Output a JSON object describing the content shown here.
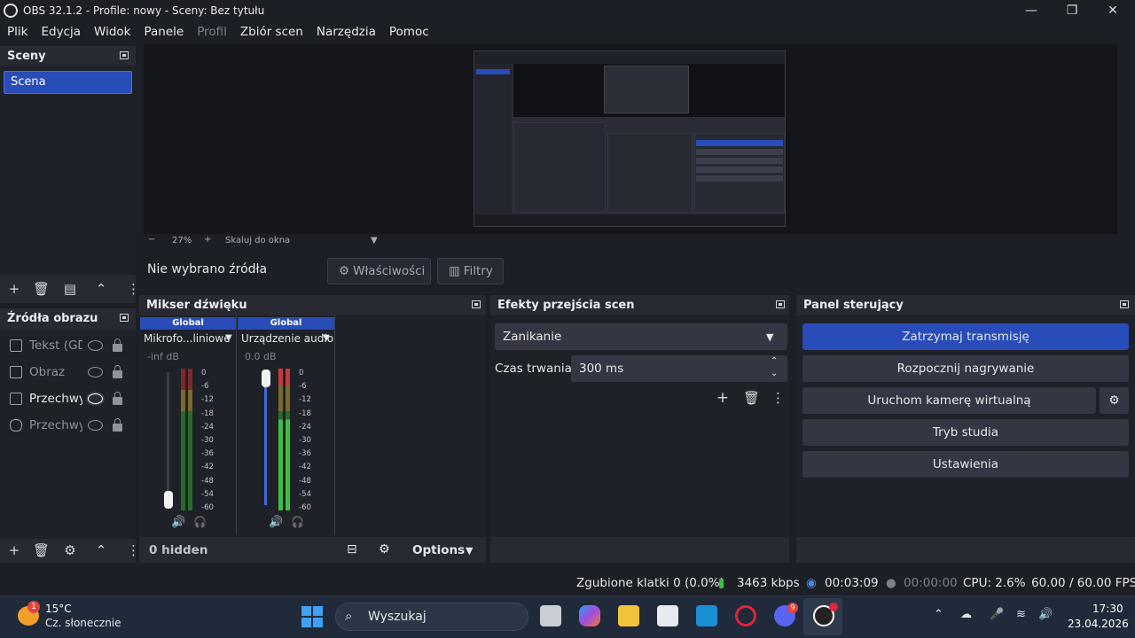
{
  "window": {
    "title": "OBS 32.1.2 - Profile: nowy - Sceny: Bez tytułu"
  },
  "menu": [
    "Plik",
    "Edycja",
    "Widok",
    "Panele",
    "Profil",
    "Zbiór scen",
    "Narzędzia",
    "Pomoc"
  ],
  "scenes": {
    "title": "Sceny",
    "items": [
      "Scena"
    ]
  },
  "sources": {
    "title": "Źródła obrazu",
    "items": [
      {
        "label": "Tekst (GDI",
        "icon": "text-icon",
        "visible": false
      },
      {
        "label": "Obraz",
        "icon": "image-icon",
        "visible": false
      },
      {
        "label": "Przechwy",
        "icon": "display-capture-icon",
        "visible": true
      },
      {
        "label": "Przechwy",
        "icon": "game-capture-icon",
        "visible": false
      }
    ]
  },
  "preview": {
    "zoom": "27%",
    "scale_mode": "Skaluj do okna",
    "minus": "−",
    "plus": "+"
  },
  "source_toolbar": {
    "no_source": "Nie wybrano źródła",
    "properties": "Właściwości",
    "filters": "Filtry"
  },
  "mixer": {
    "title": "Mikser dźwięku",
    "channels": [
      {
        "tag": "Global",
        "name": "Mikrofo...liniowe",
        "db": "-inf dB",
        "level": 0.0
      },
      {
        "tag": "Global",
        "name": "Urządzenie audio",
        "db": "0.0 dB",
        "level": 1.0
      }
    ],
    "scale": [
      "0",
      "-6",
      "-12",
      "-18",
      "-24",
      "-30",
      "-36",
      "-42",
      "-48",
      "-54",
      "-60"
    ],
    "hidden": "0 hidden",
    "options": "Options"
  },
  "transitions": {
    "title": "Efekty przejścia scen",
    "selected": "Zanikanie",
    "duration_label": "Czas trwania",
    "duration": "300 ms"
  },
  "controls": {
    "title": "Panel sterujący",
    "buttons": [
      "Zatrzymaj transmisję",
      "Rozpocznij nagrywanie",
      "Uruchom kamerę wirtualną",
      "Tryb studia",
      "Ustawienia"
    ]
  },
  "status": {
    "dropped": "Zgubione klatki 0 (0.0%)",
    "bitrate": "3463 kbps",
    "stream_time": "00:03:09",
    "rec_time": "00:00:00",
    "cpu": "CPU: 2.6%",
    "fps": "60.00 / 60.00 FPS"
  },
  "taskbar": {
    "weather_temp": "15°C",
    "weather_desc": "Cz. słonecznie",
    "weather_badge": "1",
    "search": "Wyszukaj",
    "discord_badge": "9",
    "time": "17:30",
    "date": "23.04.2026"
  },
  "colors": {
    "accent": "#284cb8",
    "panel": "#272a33",
    "bg": "#1d1f26",
    "meter_green": "#3fbf3f",
    "meter_yellow": "#c9b93a",
    "meter_red": "#c63a3a"
  }
}
